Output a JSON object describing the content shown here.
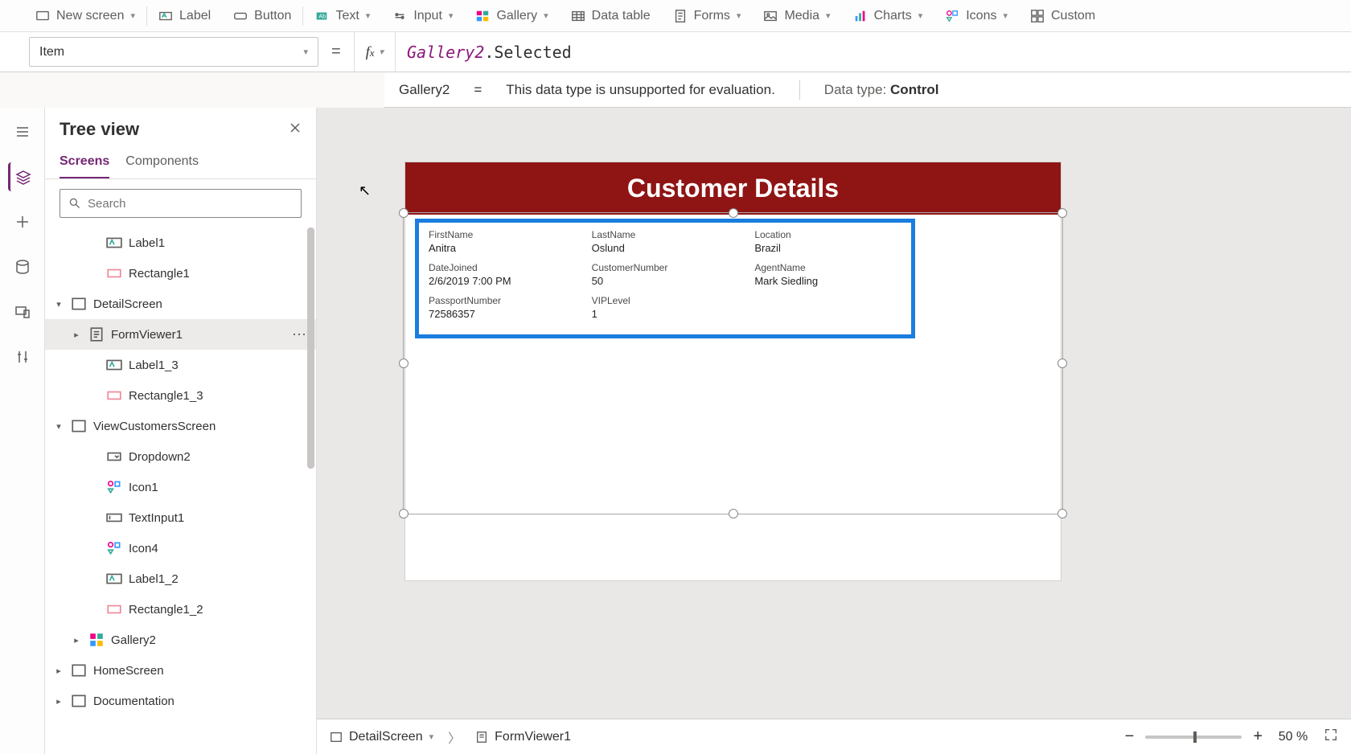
{
  "ribbon": {
    "newScreen": "New screen",
    "label": "Label",
    "button": "Button",
    "text": "Text",
    "input": "Input",
    "gallery": "Gallery",
    "dataTable": "Data table",
    "forms": "Forms",
    "media": "Media",
    "charts": "Charts",
    "icons": "Icons",
    "custom": "Custom"
  },
  "propertyDropdown": "Item",
  "formula": {
    "object": "Gallery2",
    "rest": ".Selected"
  },
  "eval": {
    "lhs": "Gallery2",
    "eq": "=",
    "msg": "This data type is unsupported for evaluation.",
    "dtLabel": "Data type:",
    "dtVal": "Control"
  },
  "treePanel": {
    "title": "Tree view",
    "tabs": {
      "screens": "Screens",
      "components": "Components"
    },
    "searchPlaceholder": "Search"
  },
  "tree": {
    "label1": "Label1",
    "rectangle1": "Rectangle1",
    "detailScreen": "DetailScreen",
    "formViewer1": "FormViewer1",
    "label1_3": "Label1_3",
    "rectangle1_3": "Rectangle1_3",
    "viewCustomersScreen": "ViewCustomersScreen",
    "dropdown2": "Dropdown2",
    "icon1": "Icon1",
    "textInput1": "TextInput1",
    "icon4": "Icon4",
    "label1_2": "Label1_2",
    "rectangle1_2": "Rectangle1_2",
    "gallery2": "Gallery2",
    "homeScreen": "HomeScreen",
    "documentation": "Documentation"
  },
  "canvas": {
    "headerTitle": "Customer Details",
    "fields": [
      {
        "label": "FirstName",
        "value": "Anitra"
      },
      {
        "label": "LastName",
        "value": "Oslund"
      },
      {
        "label": "Location",
        "value": "Brazil"
      },
      {
        "label": "DateJoined",
        "value": "2/6/2019 7:00 PM"
      },
      {
        "label": "CustomerNumber",
        "value": "50"
      },
      {
        "label": "AgentName",
        "value": "Mark Siedling"
      },
      {
        "label": "PassportNumber",
        "value": "72586357"
      },
      {
        "label": "VIPLevel",
        "value": "1"
      }
    ]
  },
  "breadcrumb": {
    "screen": "DetailScreen",
    "control": "FormViewer1"
  },
  "zoom": {
    "pct": "50",
    "suffix": "%"
  }
}
